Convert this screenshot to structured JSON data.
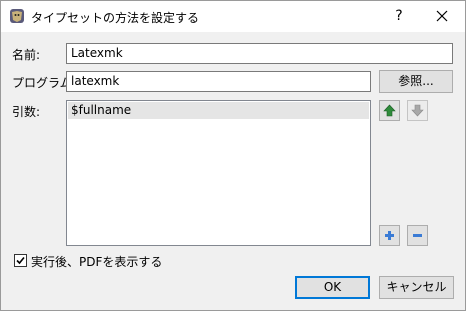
{
  "window": {
    "title": "タイプセットの方法を設定する",
    "help_label": "?",
    "app_icon": "texworks-lion-icon",
    "close_icon": "close-icon"
  },
  "form": {
    "name_label": "名前:",
    "name_value": "Latexmk",
    "program_label": "プログラム:",
    "program_value": "latexmk",
    "browse_label": "参照...",
    "args_label": "引数:",
    "args_items": [
      "$fullname"
    ]
  },
  "arg_buttons": {
    "move_up_icon": "arrow-up-icon",
    "move_down_icon": "arrow-down-icon",
    "add_icon": "plus-icon",
    "remove_icon": "minus-icon"
  },
  "options": {
    "show_pdf_label": "実行後、PDFを表示する",
    "show_pdf_checked": true
  },
  "footer": {
    "ok_label": "OK",
    "cancel_label": "キャンセル"
  },
  "colors": {
    "accent": "#0078d7",
    "up_arrow": "#2e8b3a",
    "add_icon": "#3a7bd5"
  }
}
